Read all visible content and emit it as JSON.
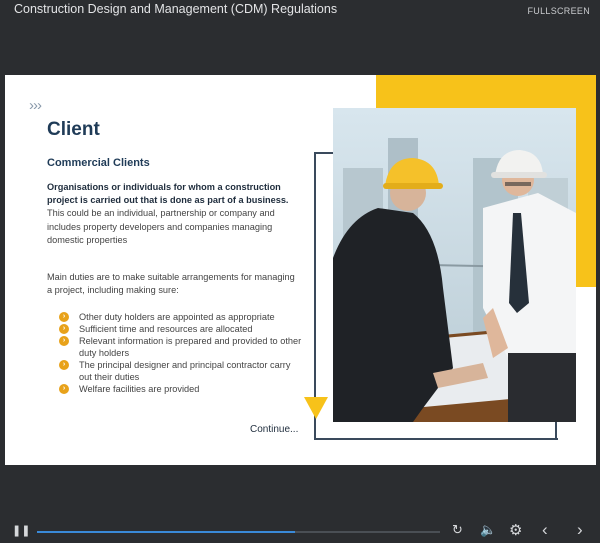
{
  "header": {
    "title": "Construction Design and Management (CDM) Regulations",
    "fullscreen_label": "FULLSCREEN"
  },
  "slide": {
    "chevrons": "›››",
    "heading": "Client",
    "subheading": "Commercial Clients",
    "intro_bold": "Organisations or individuals for whom a construction project is carried out that is done as part of a business.",
    "intro_rest": " This could be an individual, partnership or company and includes property developers and companies managing domestic properties",
    "duties_intro": "Main duties are to make suitable arrangements for managing a project, including making sure:",
    "bullets": [
      "Other duty holders are appointed as appropriate",
      "Sufficient time and resources are allocated",
      "Relevant information is prepared and provided to other duty holders",
      "The principal designer and principal contractor carry out their duties",
      "Welfare facilities are provided"
    ],
    "continue_label": "Continue...",
    "accent_color": "#f7c21a",
    "heading_color": "#1f3b57"
  },
  "player": {
    "progress": 0.64,
    "icons": [
      "pause-icon",
      "replay-icon",
      "volume-icon",
      "settings-icon",
      "prev-icon",
      "next-icon"
    ]
  }
}
